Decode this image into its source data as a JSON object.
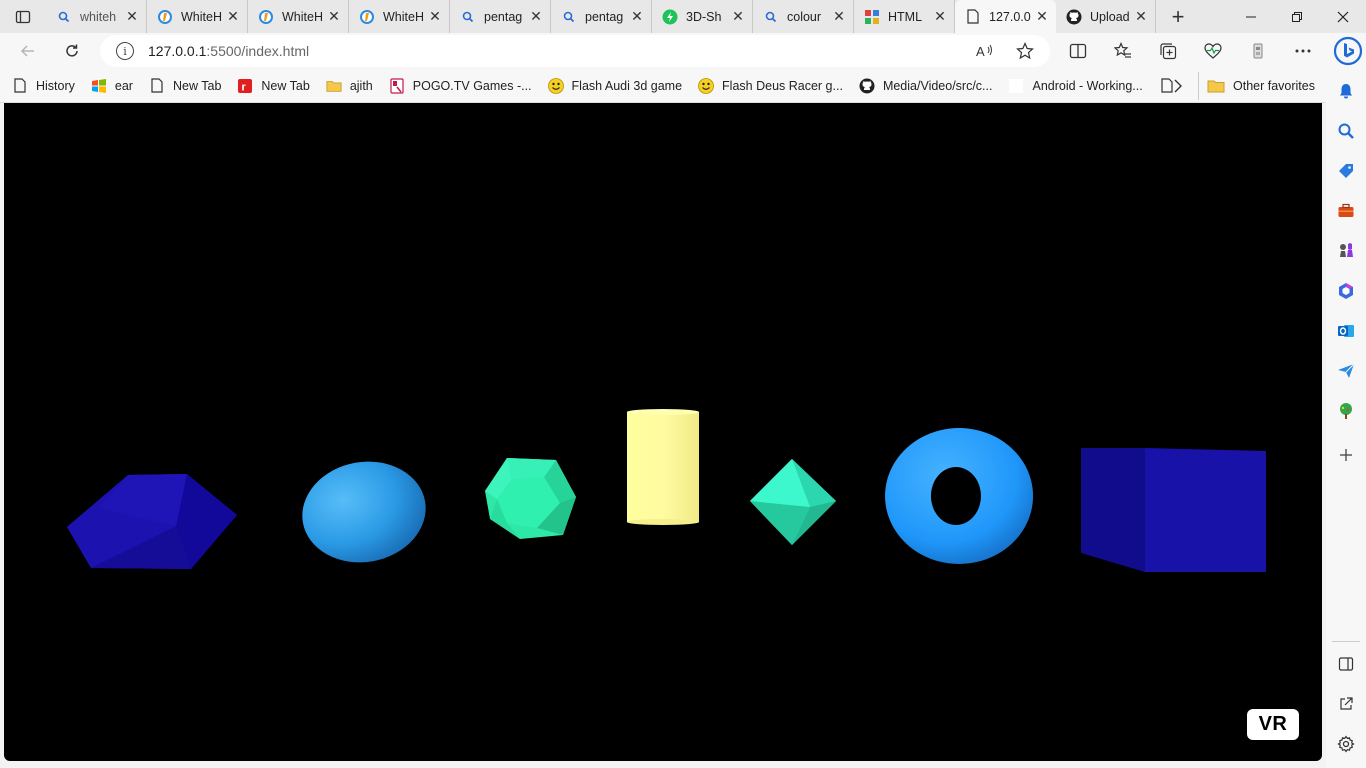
{
  "tabs": [
    {
      "label": "whiteh",
      "icon": "search-icon",
      "active": false
    },
    {
      "label": "WhiteH",
      "icon": "whitehat-jr-icon",
      "active": false
    },
    {
      "label": "WhiteH",
      "icon": "whitehat-jr-icon",
      "active": false
    },
    {
      "label": "WhiteH",
      "icon": "whitehat-jr-icon",
      "active": false
    },
    {
      "label": "pentag",
      "icon": "search-icon",
      "active": false
    },
    {
      "label": "pentag",
      "icon": "search-icon",
      "active": false
    },
    {
      "label": "3D-Sh",
      "icon": "green-bolt-icon",
      "active": false
    },
    {
      "label": "colour",
      "icon": "search-icon",
      "active": false
    },
    {
      "label": "HTML",
      "icon": "color-grid-icon",
      "active": false
    },
    {
      "label": "127.0.0",
      "icon": "page-icon",
      "active": true
    },
    {
      "label": "Upload",
      "icon": "github-icon",
      "active": false
    }
  ],
  "address": {
    "host": "127.0.0.1",
    "path": ":5500/index.html"
  },
  "favorites": [
    {
      "label": "History",
      "icon": "page-icon"
    },
    {
      "label": "ear",
      "icon": "windows-logo-icon"
    },
    {
      "label": "New Tab",
      "icon": "page-icon"
    },
    {
      "label": "New Tab",
      "icon": "red-r-icon"
    },
    {
      "label": "ajith",
      "icon": "folder-icon"
    },
    {
      "label": "POGO.TV Games -...",
      "icon": "pogo-icon"
    },
    {
      "label": "Flash Audi 3d game",
      "icon": "smiley-icon"
    },
    {
      "label": "Flash Deus Racer g...",
      "icon": "smiley-icon"
    },
    {
      "label": "Media/Video/src/c...",
      "icon": "github-icon"
    },
    {
      "label": "Android - Working...",
      "icon": "blank-icon"
    },
    {
      "label": "",
      "icon": "page-icon"
    }
  ],
  "other_favorites": "Other favorites",
  "scene": {
    "button_label": "VR",
    "shapes": [
      {
        "name": "dodecahedron-shape",
        "color": "#1a10a8"
      },
      {
        "name": "sphere-shape",
        "color": "#2a9ff0"
      },
      {
        "name": "icosahedron-shape",
        "color": "#2ee8a8"
      },
      {
        "name": "cylinder-shape",
        "color": "#ffff9a"
      },
      {
        "name": "octahedron-shape",
        "color": "#35f0c4"
      },
      {
        "name": "torus-shape",
        "color": "#22a0ff"
      },
      {
        "name": "box-shape",
        "color": "#14109a"
      }
    ]
  }
}
